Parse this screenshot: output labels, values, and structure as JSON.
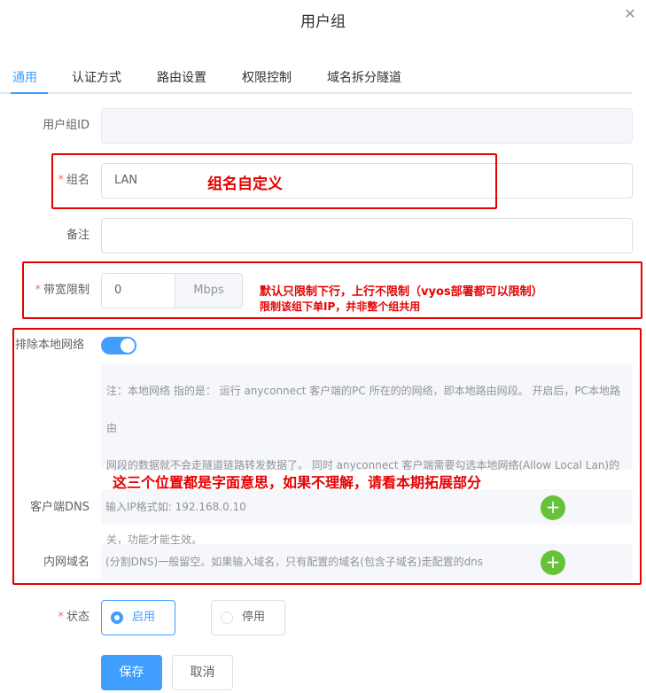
{
  "dialog": {
    "title": "用户组"
  },
  "tabs": [
    {
      "label": "通用"
    },
    {
      "label": "认证方式"
    },
    {
      "label": "路由设置"
    },
    {
      "label": "权限控制"
    },
    {
      "label": "域名拆分隧道"
    }
  ],
  "form": {
    "group_id": {
      "label": "用户组ID",
      "value": ""
    },
    "group_name": {
      "label": "组名",
      "value": "LAN"
    },
    "remark": {
      "label": "备注",
      "value": ""
    },
    "bandwidth": {
      "label": "带宽限制",
      "value": "0",
      "unit": "Mbps"
    },
    "exclude_local": {
      "label": "排除本地网络",
      "enabled": true
    },
    "note": {
      "line1": "注：本地网络 指的是： 运行 anyconnect 客户端的PC 所在的的网络，即本地路由网段。 开启后，PC本地路由",
      "line2": "网段的数据就不会走隧道链路转发数据了。 同时 anyconnect 客户端需要勾选本地网络(Allow Local Lan)的开",
      "line3": "关，功能才能生效。"
    },
    "client_dns": {
      "label": "客户端DNS",
      "placeholder": "输入IP格式如: 192.168.0.10"
    },
    "intranet_domain": {
      "label": "内网域名",
      "placeholder": "(分割DNS)一般留空。如果输入域名，只有配置的域名(包含子域名)走配置的dns"
    },
    "status": {
      "label": "状态",
      "options": [
        "启用",
        "停用"
      ],
      "selected": "启用"
    }
  },
  "buttons": {
    "save": "保存",
    "cancel": "取消"
  },
  "annotations": {
    "group_name_note": "组名自定义",
    "bandwidth_note_1": "默认只限制下行，上行不限制（vyos部署都可以限制）",
    "bandwidth_note_2": "限制该组下单IP，并非整个组共用",
    "local_note": "这三个位置都是字面意思，如果不理解，请看本期拓展部分"
  },
  "colors": {
    "primary": "#409eff",
    "danger": "#e60000",
    "success": "#67c23a"
  },
  "icons": {
    "close": "close-icon",
    "add": "plus-icon"
  }
}
